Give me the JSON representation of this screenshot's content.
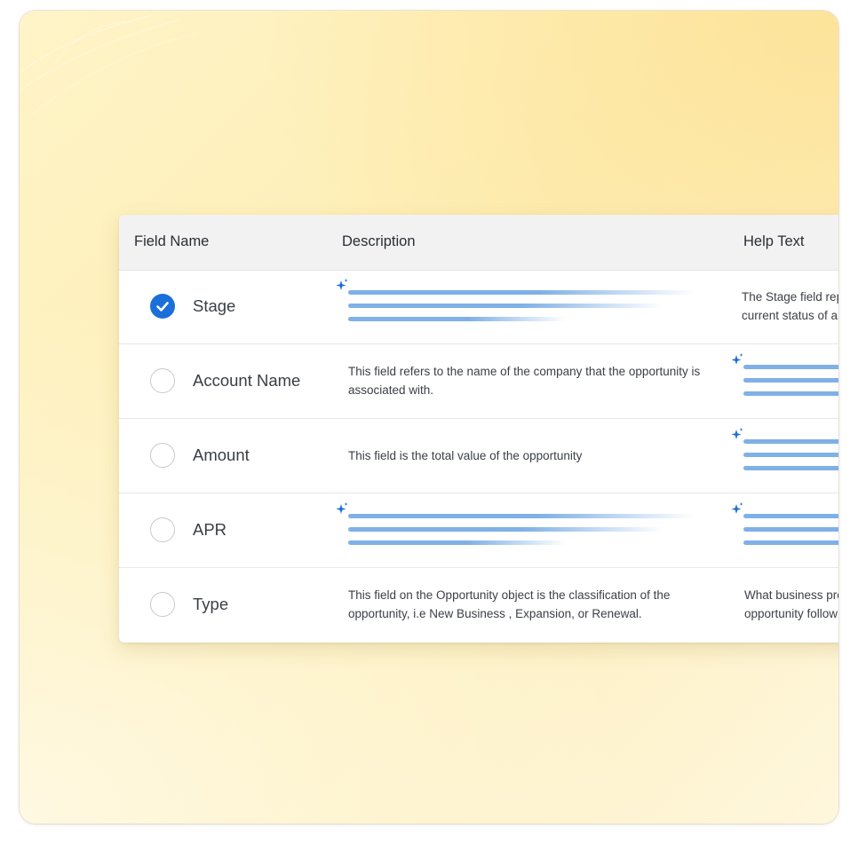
{
  "table": {
    "headers": {
      "field_name": "Field Name",
      "description": "Description",
      "help_text": "Help Text"
    },
    "rows": [
      {
        "field": "Stage",
        "checked": true,
        "description": "",
        "description_loading": true,
        "help_line1": "The Stage field repre",
        "help_line2": "current status of an",
        "help_loading": false
      },
      {
        "field": "Account Name",
        "checked": false,
        "description": "This field refers to the name of the company that the opportunity is associated with.",
        "description_loading": false,
        "help_line1": "",
        "help_line2": "",
        "help_loading": true
      },
      {
        "field": "Amount",
        "checked": false,
        "description": "This field is the total value of the opportunity",
        "description_loading": false,
        "help_line1": "",
        "help_line2": "",
        "help_loading": true
      },
      {
        "field": "APR",
        "checked": false,
        "description": "",
        "description_loading": true,
        "help_line1": "",
        "help_line2": "",
        "help_loading": true
      },
      {
        "field": "Type",
        "checked": false,
        "description": "This field on the Opportunity object is the classification of the opportunity, i.e New Business , Expansion, or Renewal.",
        "description_loading": false,
        "help_line1": "What business proc",
        "help_line2": "opportunity follow",
        "help_loading": false
      }
    ]
  },
  "colors": {
    "accent": "#1b6fd8",
    "loading_bar": "#7fb0e6",
    "sparkle": "#1b6fd8",
    "background_warm": "#fde39a"
  },
  "icons": {
    "checked": "check-circle-icon",
    "unchecked": "radio-empty-icon",
    "ai_loading": "sparkle-icon"
  }
}
